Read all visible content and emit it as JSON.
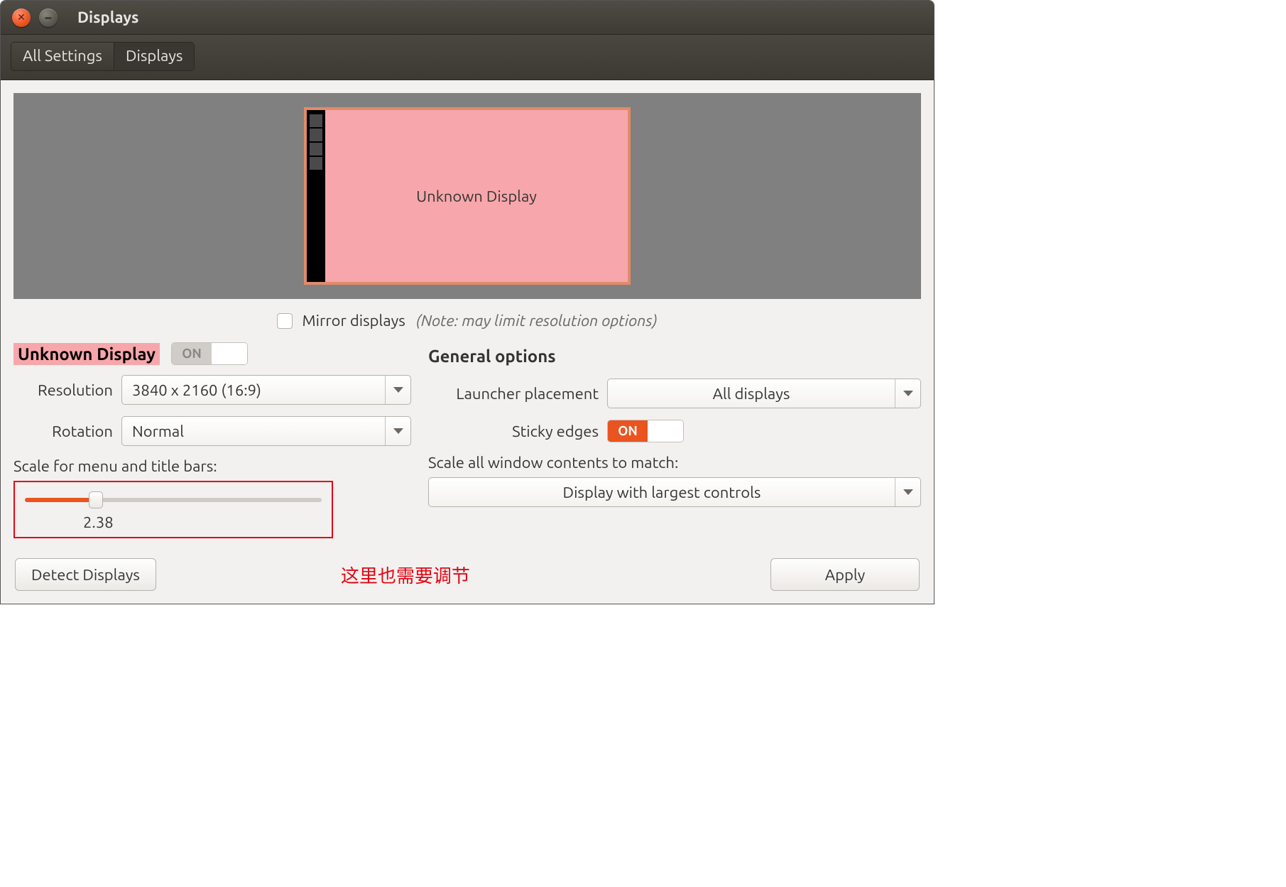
{
  "window": {
    "title": "Displays"
  },
  "breadcrumb": {
    "items": [
      "All Settings",
      "Displays"
    ]
  },
  "diagram": {
    "display_label": "Unknown Display"
  },
  "mirror": {
    "label": "Mirror displays",
    "note": "(Note: may limit resolution options)"
  },
  "left": {
    "display_name": "Unknown Display",
    "toggle_on_label": "ON",
    "rows": {
      "resolution_label": "Resolution",
      "resolution_value": "3840 x 2160 (16:9)",
      "rotation_label": "Rotation",
      "rotation_value": "Normal"
    },
    "scale": {
      "label": "Scale for menu and title bars:",
      "value": "2.38",
      "fill_percent": 24
    }
  },
  "right": {
    "heading": "General options",
    "launcher_label": "Launcher placement",
    "launcher_value": "All displays",
    "sticky_label": "Sticky edges",
    "sticky_on_label": "ON",
    "scale_all_label": "Scale all window contents to match:",
    "scale_all_value": "Display with largest controls"
  },
  "buttons": {
    "detect": "Detect Displays",
    "apply": "Apply"
  },
  "annotation": "这里也需要调节"
}
